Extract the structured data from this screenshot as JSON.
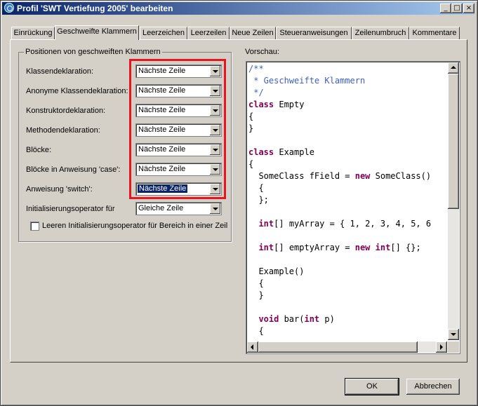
{
  "window": {
    "title": "Profil 'SWT Vertiefung 2005' bearbeiten",
    "controls": [
      "_",
      "□",
      "×"
    ]
  },
  "tabs": [
    {
      "label": "Einrückung",
      "active": false
    },
    {
      "label": "Geschweifte Klammern",
      "active": true
    },
    {
      "label": "Leerzeichen",
      "active": false
    },
    {
      "label": "Leerzeilen",
      "active": false
    },
    {
      "label": "Neue Zeilen",
      "active": false
    },
    {
      "label": "Steueranweisungen",
      "active": false
    },
    {
      "label": "Zeilenumbruch",
      "active": false
    },
    {
      "label": "Kommentare",
      "active": false
    }
  ],
  "positions_group": {
    "title": "Positionen von geschweiften Klammern",
    "rows": [
      {
        "label": "Klassendeklaration:",
        "value": "Nächste Zeile"
      },
      {
        "label": "Anonyme Klassendeklaration:",
        "value": "Nächste Zeile"
      },
      {
        "label": "Konstruktordeklaration:",
        "value": "Nächste Zeile"
      },
      {
        "label": "Methodendeklaration:",
        "value": "Nächste Zeile"
      },
      {
        "label": "Blöcke:",
        "value": "Nächste Zeile"
      },
      {
        "label": "Blöcke in Anweisung 'case':",
        "value": "Nächste Zeile"
      },
      {
        "label": "Anweisung 'switch':",
        "value": "Nächste Zeile",
        "focused": true
      },
      {
        "label": "Initialisierungsoperator für",
        "value": "Gleiche Zeile"
      }
    ],
    "checkbox_label": "Leeren Initialisierungsoperator für Bereich in einer Zeil",
    "checkbox_checked": false
  },
  "preview": {
    "label": "Vorschau:",
    "lines": [
      [
        {
          "t": "/**",
          "s": "c"
        }
      ],
      [
        {
          "t": " * Geschweifte Klammern",
          "s": "c"
        }
      ],
      [
        {
          "t": " */",
          "s": "c"
        }
      ],
      [
        {
          "t": "class",
          "s": "k"
        },
        {
          "t": " Empty",
          "s": ""
        }
      ],
      [
        {
          "t": "{",
          "s": ""
        }
      ],
      [
        {
          "t": "}",
          "s": ""
        }
      ],
      [
        {
          "t": "",
          "s": ""
        }
      ],
      [
        {
          "t": "class",
          "s": "k"
        },
        {
          "t": " Example",
          "s": ""
        }
      ],
      [
        {
          "t": "{",
          "s": ""
        }
      ],
      [
        {
          "t": "  SomeClass fField = ",
          "s": ""
        },
        {
          "t": "new",
          "s": "k"
        },
        {
          "t": " SomeClass()",
          "s": ""
        }
      ],
      [
        {
          "t": "  {",
          "s": ""
        }
      ],
      [
        {
          "t": "  };",
          "s": ""
        }
      ],
      [
        {
          "t": "",
          "s": ""
        }
      ],
      [
        {
          "t": "  ",
          "s": ""
        },
        {
          "t": "int",
          "s": "k"
        },
        {
          "t": "[] myArray = { 1, 2, 3, 4, 5, 6",
          "s": ""
        }
      ],
      [
        {
          "t": "",
          "s": ""
        }
      ],
      [
        {
          "t": "  ",
          "s": ""
        },
        {
          "t": "int",
          "s": "k"
        },
        {
          "t": "[] emptyArray = ",
          "s": ""
        },
        {
          "t": "new",
          "s": "k"
        },
        {
          "t": " ",
          "s": ""
        },
        {
          "t": "int",
          "s": "k"
        },
        {
          "t": "[] {};",
          "s": ""
        }
      ],
      [
        {
          "t": "",
          "s": ""
        }
      ],
      [
        {
          "t": "  Example()",
          "s": ""
        }
      ],
      [
        {
          "t": "  {",
          "s": ""
        }
      ],
      [
        {
          "t": "  }",
          "s": ""
        }
      ],
      [
        {
          "t": "",
          "s": ""
        }
      ],
      [
        {
          "t": "  ",
          "s": ""
        },
        {
          "t": "void",
          "s": "k"
        },
        {
          "t": " bar(",
          "s": ""
        },
        {
          "t": "int",
          "s": "k"
        },
        {
          "t": " p)",
          "s": ""
        }
      ],
      [
        {
          "t": "  {",
          "s": ""
        }
      ]
    ]
  },
  "buttons": {
    "ok": "OK",
    "cancel": "Abbrechen"
  },
  "colors": {
    "highlight_box": "#e8141e",
    "title_bar": "#0a246a",
    "comment": "#3f5fbf",
    "keyword": "#7f0055"
  }
}
